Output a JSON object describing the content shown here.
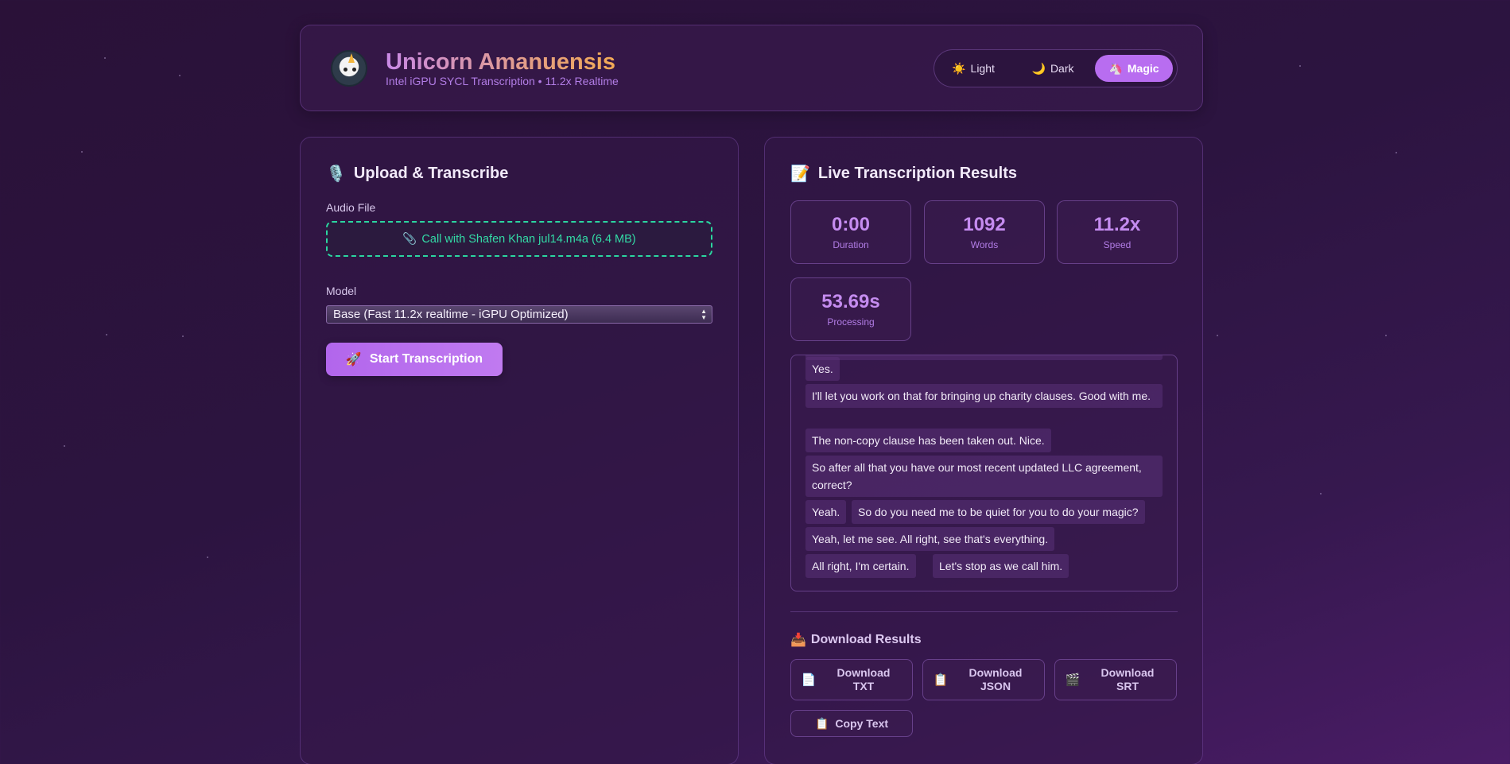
{
  "header": {
    "title": "Unicorn Amanuensis",
    "subtitle": "Intel iGPU SYCL Transcription • 11.2x Realtime",
    "theme_options": [
      {
        "icon": "sun-icon",
        "glyph": "☀️",
        "label": "Light"
      },
      {
        "icon": "moon-icon",
        "glyph": "🌙",
        "label": "Dark"
      },
      {
        "icon": "unicorn-icon",
        "glyph": "🦄",
        "label": "Magic",
        "active": true
      }
    ]
  },
  "upload": {
    "icon_glyph": "🎙️",
    "title": "Upload & Transcribe",
    "audio_label": "Audio File",
    "file_icon_glyph": "📎",
    "file_name": "Call with Shafen Khan jul14.m4a (6.4 MB)",
    "model_label": "Model",
    "model_selected": "Base (Fast 11.2x realtime - iGPU Optimized)",
    "start_icon_glyph": "🚀",
    "start_label": "Start Transcription"
  },
  "results": {
    "icon_glyph": "📝",
    "title": "Live Transcription Results",
    "stats": [
      {
        "value": "0:00",
        "label": "Duration"
      },
      {
        "value": "1092",
        "label": "Words"
      },
      {
        "value": "11.2x",
        "label": "Speed"
      },
      {
        "value": "53.69s",
        "label": "Processing"
      }
    ],
    "segments": [
      "Yes.",
      "I'll let you work on that for bringing up charity clauses. Good with me.",
      "The non-copy clause has been taken out. Nice.",
      "So after all that you have our most recent updated LLC agreement, correct?",
      "Yeah.",
      "So do you need me to be quiet for you to do your magic?",
      "Yeah, let me see. All right, see that's everything.",
      "All right, I'm certain.",
      "Let's stop as we call him."
    ]
  },
  "downloads": {
    "icon_glyph": "📥",
    "title": "Download Results",
    "buttons": [
      {
        "icon": "document-icon",
        "glyph": "📄",
        "label": "Download TXT"
      },
      {
        "icon": "clipboard-icon",
        "glyph": "📋",
        "label": "Download JSON"
      },
      {
        "icon": "clapper-icon",
        "glyph": "🎬",
        "label": "Download SRT"
      }
    ],
    "copy_glyph": "📋",
    "copy_label": "Copy Text"
  },
  "colors": {
    "accent": "#b86df0",
    "file_border": "#2bd6a0",
    "stat_value": "#c58cf0"
  }
}
